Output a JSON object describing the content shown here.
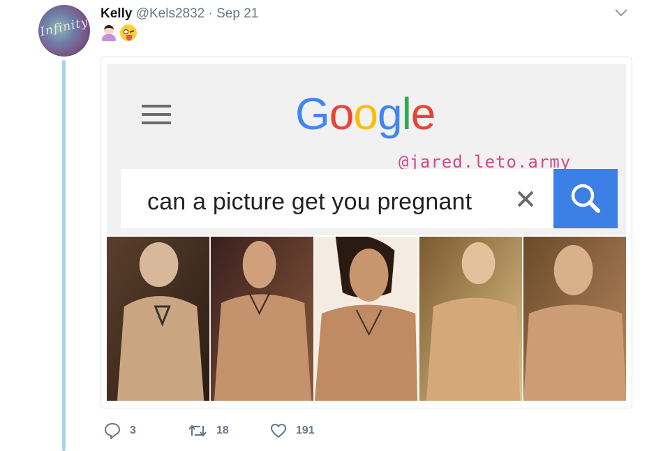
{
  "tweet": {
    "author_name": "Kelly",
    "handle": "@Kels2832",
    "separator": "·",
    "date": "Sep 21",
    "avatar_text": "Infinity",
    "emojis": [
      "woman-tipping-hand",
      "winking-face-with-tongue"
    ]
  },
  "media": {
    "google_logo_letters": [
      {
        "char": "G",
        "color": "#4285F4"
      },
      {
        "char": "o",
        "color": "#EA4335"
      },
      {
        "char": "o",
        "color": "#FBBC05"
      },
      {
        "char": "g",
        "color": "#4285F4"
      },
      {
        "char": "l",
        "color": "#34A853"
      },
      {
        "char": "e",
        "color": "#EA4335"
      }
    ],
    "watermark": "@jared.leto.army",
    "search_query": "can a picture get you pregnant",
    "search_button_color": "#3c80e6",
    "photo_count": 5
  },
  "actions": {
    "replies": "3",
    "retweets": "18",
    "likes": "191"
  },
  "colors": {
    "thread_line": "#a9d3f0",
    "muted_text": "#657786",
    "watermark": "#d6458c"
  }
}
